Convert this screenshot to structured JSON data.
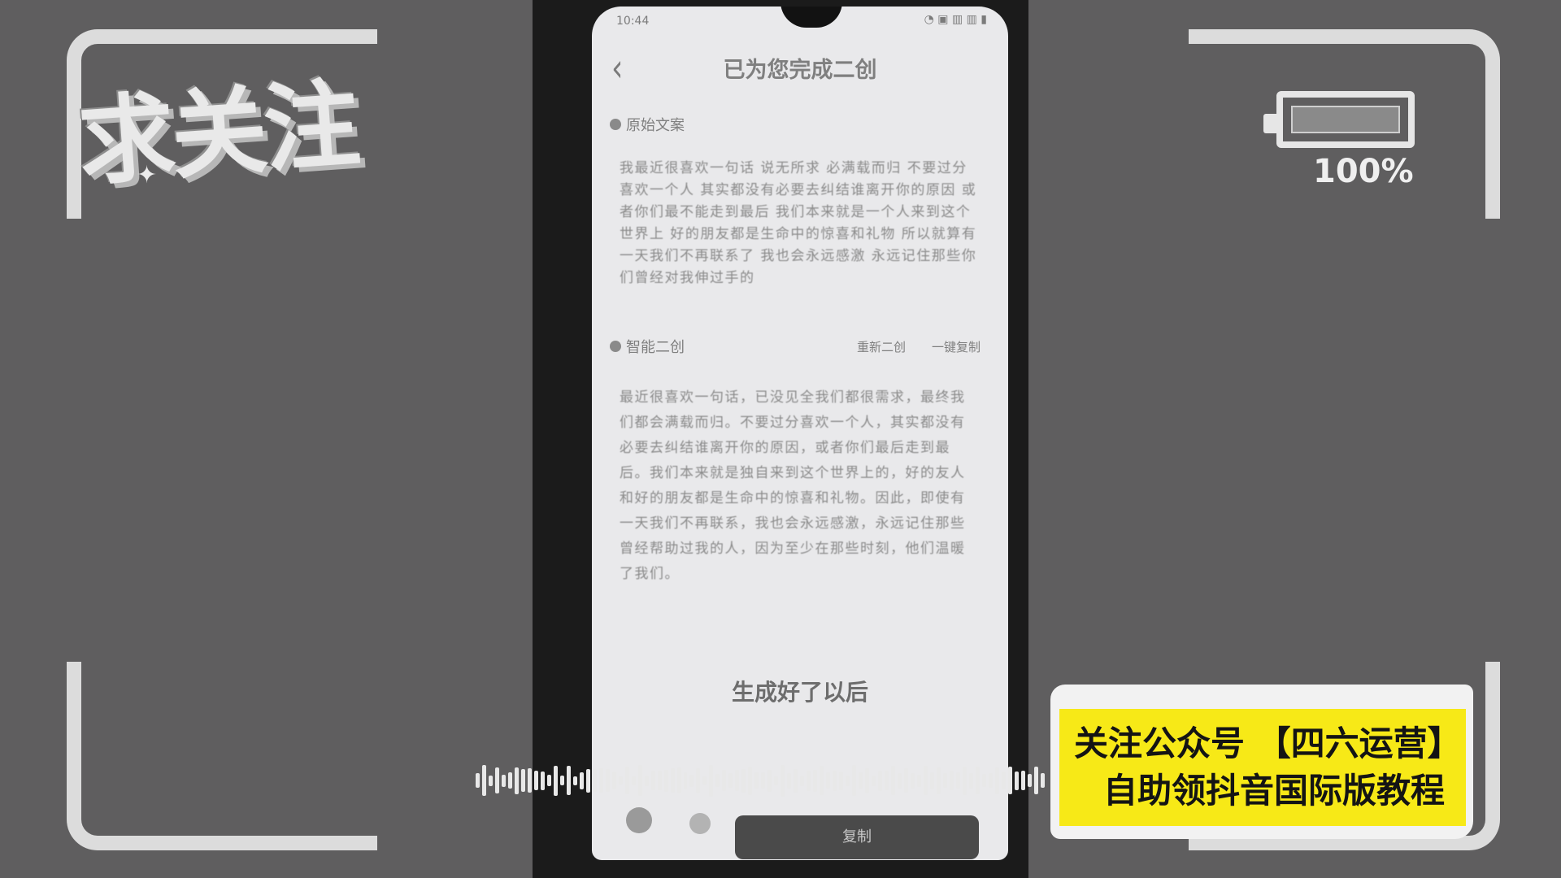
{
  "overlay": {
    "follow_text": "求关注",
    "battery_percent": "100%",
    "promo_line1": "关注公众号 【四六运营】",
    "promo_line2": "自助领抖音国际版教程"
  },
  "phone": {
    "status_time": "10:44",
    "status_right": "◔ ▣ ▥ ▥ ▮",
    "title": "已为您完成二创",
    "section1_label": "原始文案",
    "section1_text": "我最近很喜欢一句话 说无所求 必满载而归 不要过分喜欢一个人 其实都没有必要去纠结谁离开你的原因 或者你们最不能走到最后 我们本来就是一个人来到这个世界上 好的朋友都是生命中的惊喜和礼物 所以就算有一天我们不再联系了 我也会永远感激 永远记住那些你们曾经对我伸过手的",
    "section2_label": "智能二创",
    "section2_action1": "重新二创",
    "section2_action2": "一键复制",
    "section2_text": "最近很喜欢一句话，已没见全我们都很需求，最终我们都会满载而归。不要过分喜欢一个人，其实都没有必要去纠结谁离开你的原因，或者你们最后走到最后。我们本来就是独自来到这个世界上的，好的友人和好的朋友都是生命中的惊喜和礼物。因此，即使有一天我们不再联系，我也会永远感激，永远记住那些曾经帮助过我的人，因为至少在那些时刻，他们温暖了我们。",
    "subtitle": "生成好了以后",
    "button_label": "复制"
  }
}
